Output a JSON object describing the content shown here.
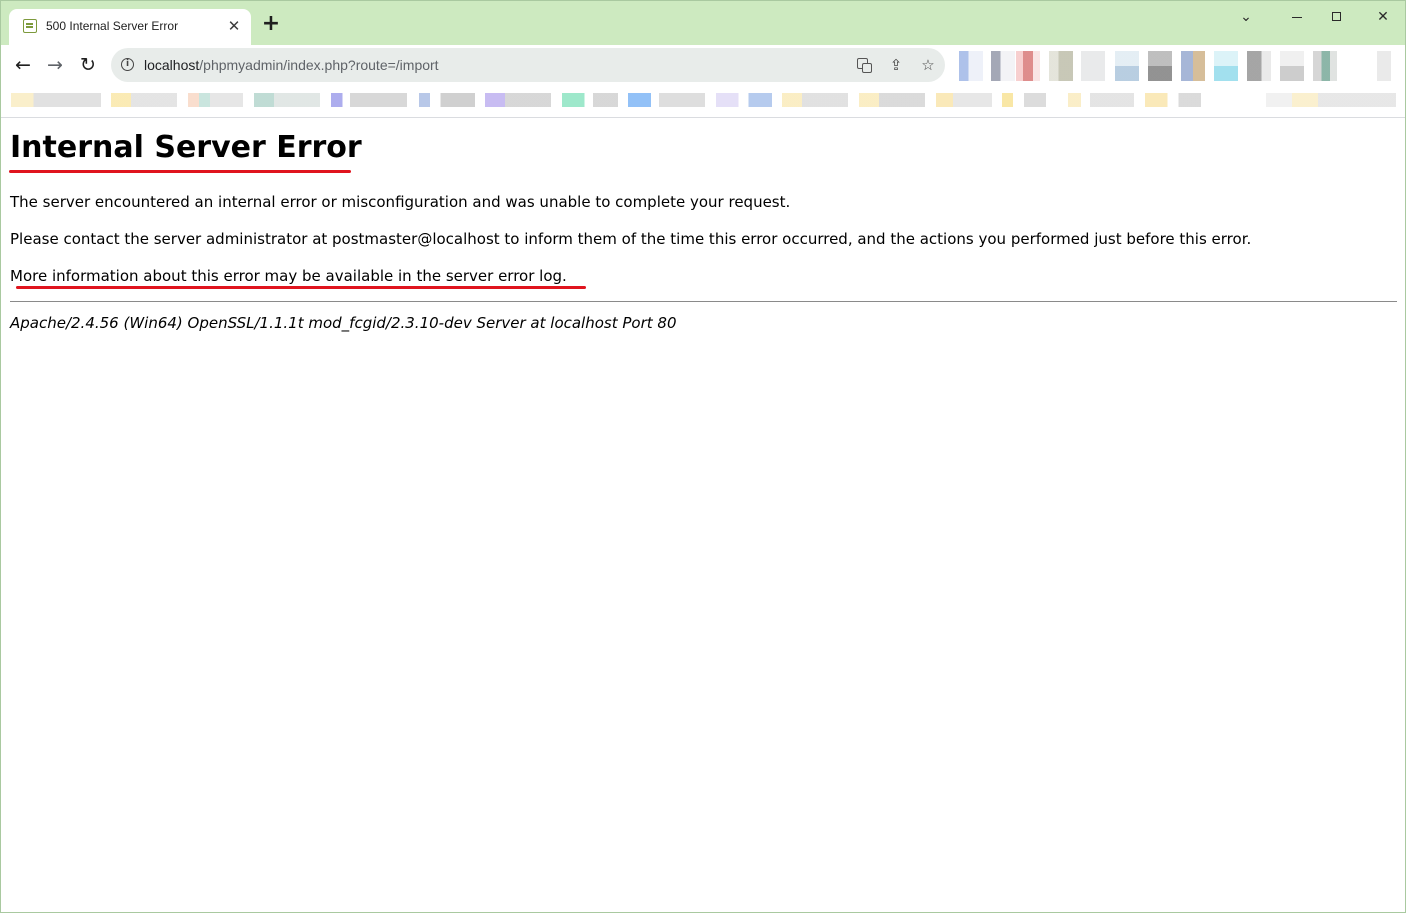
{
  "tab": {
    "title": "500 Internal Server Error",
    "close_glyph": "✕",
    "new_tab_glyph": "+"
  },
  "window_controls": {
    "dropdown_glyph": "⌄",
    "close_glyph": "✕"
  },
  "toolbar": {
    "back_glyph": "←",
    "forward_glyph": "→",
    "reload_glyph": "↻",
    "url_host": "localhost",
    "url_path": "/phpmyadmin/index.php?route=/import",
    "share_glyph": "⇪",
    "star_glyph": "☆"
  },
  "page": {
    "title": "Internal Server Error",
    "paragraph_1": "The server encountered an internal error or misconfiguration and was unable to complete your request.",
    "paragraph_2": "Please contact the server administrator at postmaster@localhost to inform them of the time this error occurred, and the actions you performed just before this error.",
    "paragraph_3": "More information about this error may be available in the server error log.",
    "server_signature": "Apache/2.4.56 (Win64) OpenSSL/1.1.1t mod_fcgid/2.3.10-dev Server at localhost Port 80"
  },
  "colors": {
    "tabstrip_bg": "#cdeac0",
    "annotation_red": "#e0141e",
    "omnibox_bg": "#e8ecea"
  }
}
